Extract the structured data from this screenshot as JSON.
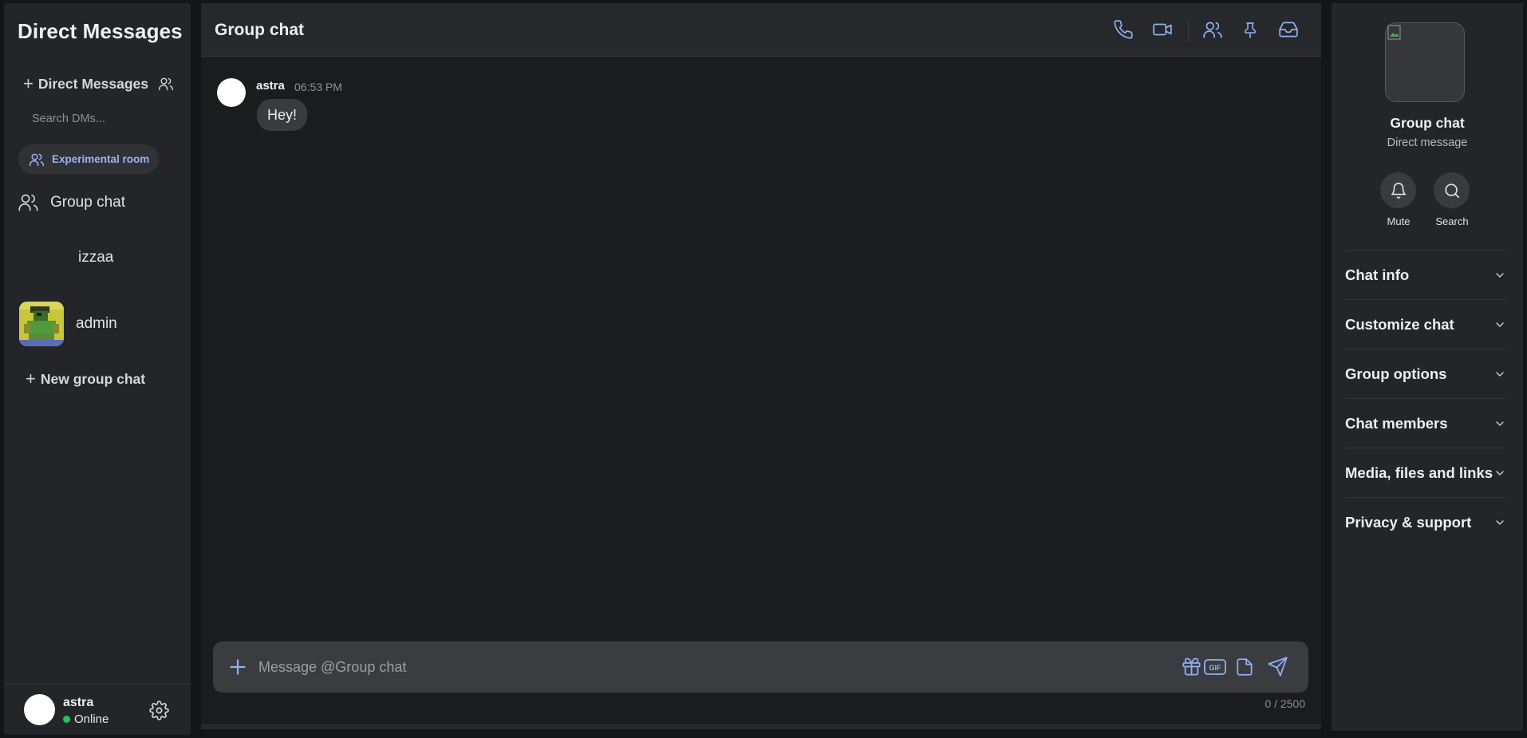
{
  "sidebar": {
    "title": "Direct Messages",
    "new_dm_label": "Direct Messages",
    "search_placeholder": "Search DMs...",
    "chip_label": "Experimental room",
    "items": [
      {
        "label": "Group chat",
        "icon": "users-icon"
      },
      {
        "label": "izzaa",
        "icon": ""
      },
      {
        "label": "admin",
        "icon": "pixel-avatar"
      }
    ],
    "new_group_label": "New group chat"
  },
  "user": {
    "name": "astra",
    "status": "Online",
    "status_color": "#22c55e"
  },
  "header": {
    "title": "Group chat",
    "icons": [
      "phone-icon",
      "video-icon",
      "members-icon",
      "pin-icon",
      "inbox-icon"
    ],
    "accent": "#8fb0f5"
  },
  "messages": [
    {
      "author": "astra",
      "time": "06:53 PM",
      "text": "Hey!"
    }
  ],
  "composer": {
    "placeholder": "Message @Group chat",
    "counter": "0 / 2500",
    "icons": [
      "gift-icon",
      "gif-icon",
      "file-icon",
      "send-icon"
    ]
  },
  "panel": {
    "title": "Group chat",
    "subtitle": "Direct message",
    "actions": [
      "Mute",
      "Search"
    ],
    "sections": [
      "Chat info",
      "Customize chat",
      "Group options",
      "Chat members",
      "Media, files and links",
      "Privacy & support"
    ]
  }
}
